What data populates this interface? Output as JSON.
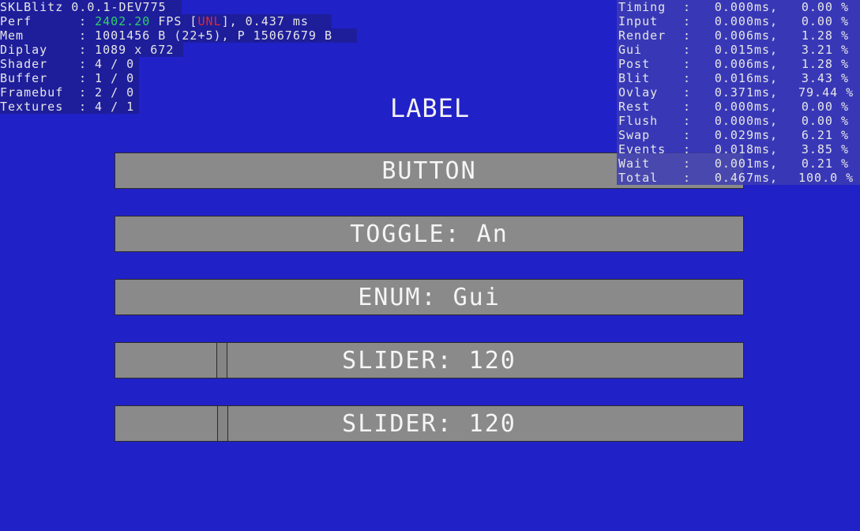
{
  "stats": {
    "title": "SKLBlitz 0.0.1-DEV775",
    "perf_key": "Perf",
    "perf_fps": "2402.20",
    "perf_fps_label": "FPS [",
    "perf_mode": "UNL",
    "perf_rest": "], 0.437 ms",
    "mem_key": "Mem",
    "mem_value": ": 1001456 B (22+5), P 15067679 B",
    "display_key": "Diplay",
    "display_value": ": 1089 x 672",
    "shader_key": "Shader",
    "shader_value": ": 4 / 0",
    "buffer_key": "Buffer",
    "buffer_value": ": 1 / 0",
    "framebuf_key": "Framebuf",
    "framebuf_value": ": 2 / 0",
    "textures_key": "Textures",
    "textures_value": ": 4 / 1",
    "colon": ":"
  },
  "timing": {
    "rows": [
      {
        "name": "Timing",
        "ms": "0.000",
        "unit": "ms,",
        "pct": "0.00 %"
      },
      {
        "name": "Input",
        "ms": "0.000",
        "unit": "ms,",
        "pct": "0.00 %"
      },
      {
        "name": "Render",
        "ms": "0.006",
        "unit": "ms,",
        "pct": "1.28 %"
      },
      {
        "name": "Gui",
        "ms": "0.015",
        "unit": "ms,",
        "pct": "3.21 %"
      },
      {
        "name": "Post",
        "ms": "0.006",
        "unit": "ms,",
        "pct": "1.28 %"
      },
      {
        "name": "Blit",
        "ms": "0.016",
        "unit": "ms,",
        "pct": "3.43 %"
      },
      {
        "name": "Ovlay",
        "ms": "0.371",
        "unit": "ms,",
        "pct": "79.44 %"
      },
      {
        "name": "Rest",
        "ms": "0.000",
        "unit": "ms,",
        "pct": "0.00 %"
      },
      {
        "name": "Flush",
        "ms": "0.000",
        "unit": "ms,",
        "pct": "0.00 %"
      },
      {
        "name": "Swap",
        "ms": "0.029",
        "unit": "ms,",
        "pct": "6.21 %"
      },
      {
        "name": "Events",
        "ms": "0.018",
        "unit": "ms,",
        "pct": "3.85 %"
      },
      {
        "name": "Wait",
        "ms": "0.001",
        "unit": "ms,",
        "pct": "0.21 %"
      },
      {
        "name": "Total",
        "ms": "0.467",
        "unit": "ms,",
        "pct": "100.0 %"
      }
    ]
  },
  "gui": {
    "label": "LABEL",
    "button": "BUTTON",
    "toggle": "TOGGLE: An",
    "enum": "ENUM: Gui",
    "slider1": "SLIDER: 120",
    "slider1_value": 120,
    "slider2": "SLIDER: 120",
    "slider2_value": 120
  }
}
